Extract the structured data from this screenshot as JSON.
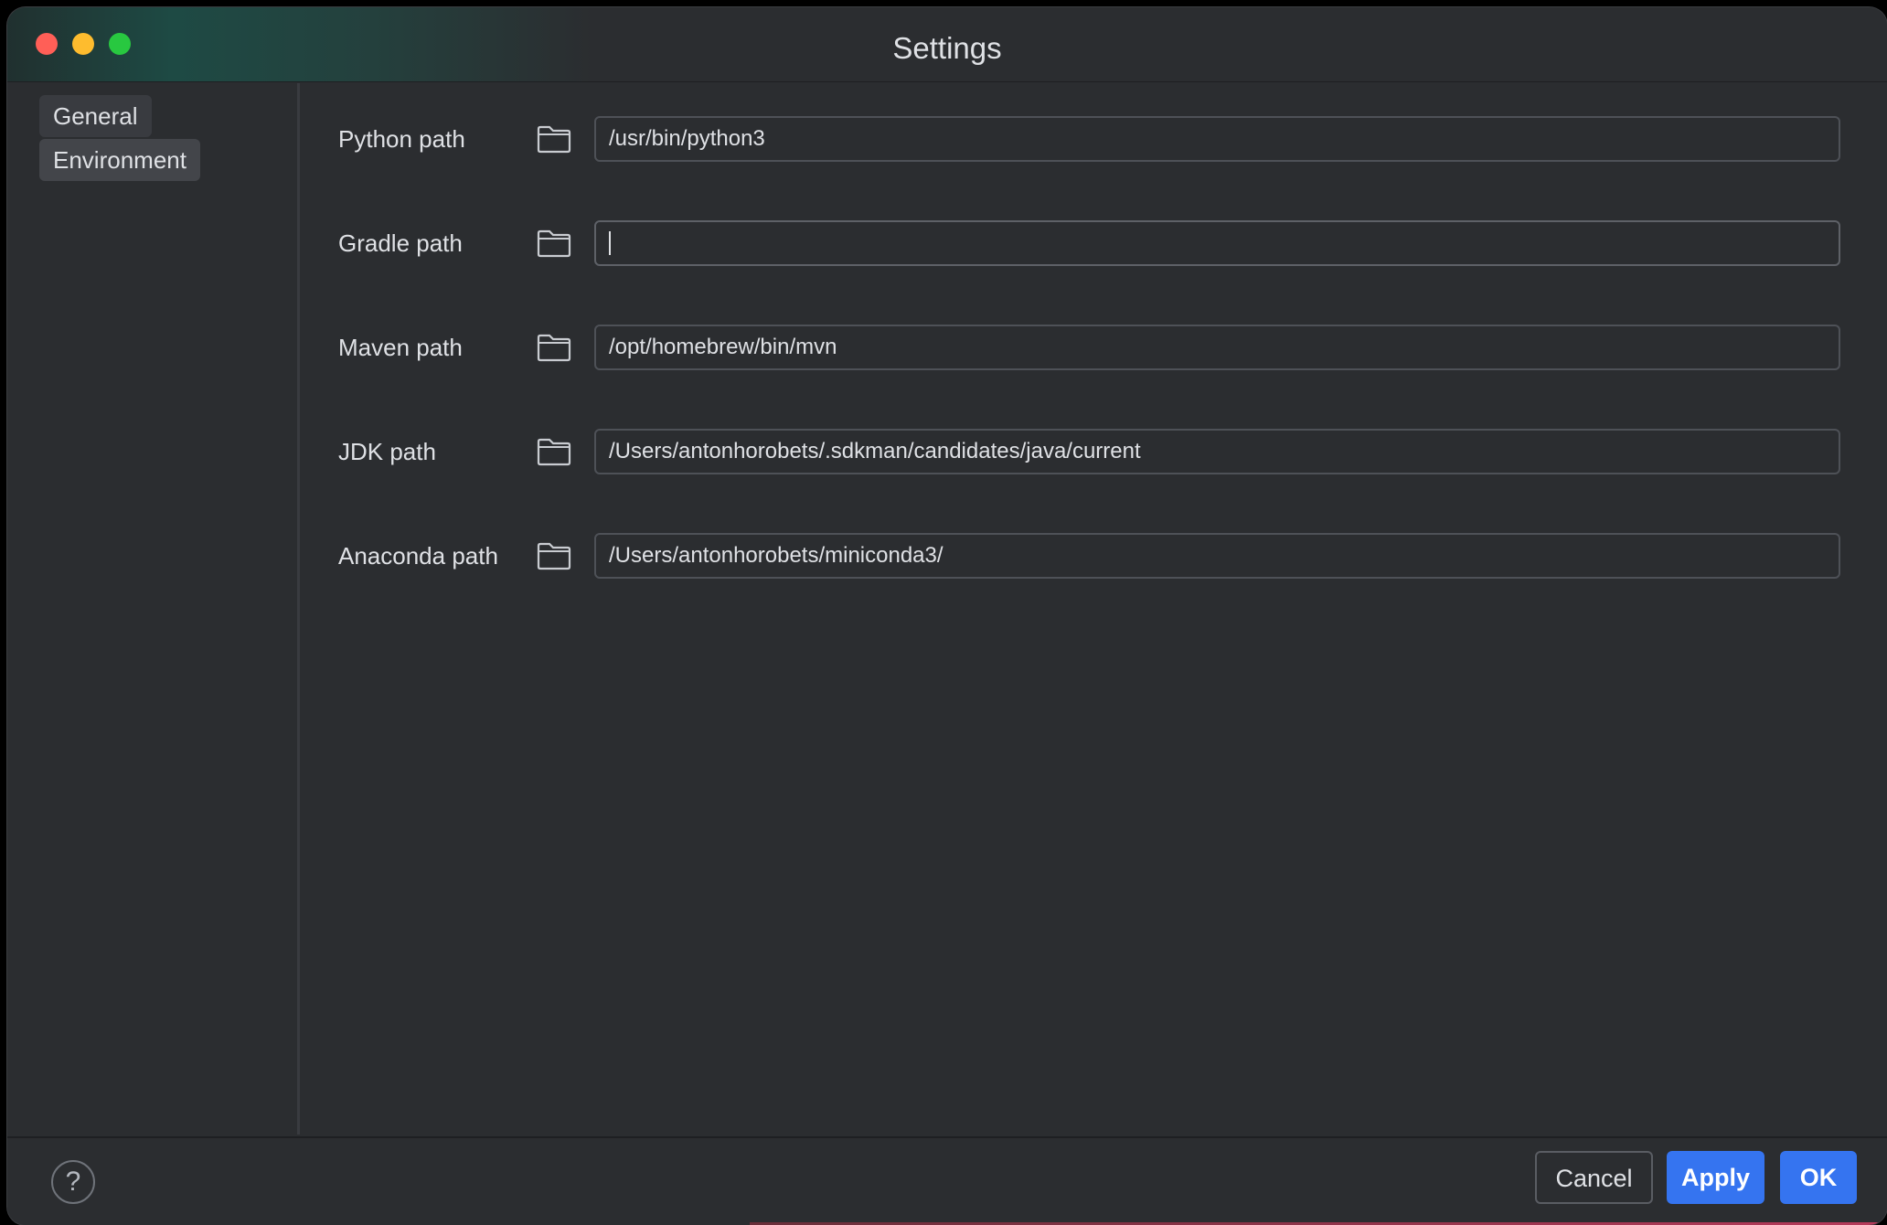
{
  "window": {
    "title": "Settings"
  },
  "sidebar": {
    "items": [
      {
        "label": "General",
        "selected": false
      },
      {
        "label": "Environment",
        "selected": true
      }
    ]
  },
  "environment": {
    "rows": [
      {
        "label": "Python path",
        "value": "/usr/bin/python3",
        "placeholder": ""
      },
      {
        "label": "Gradle path",
        "value": "",
        "placeholder": ""
      },
      {
        "label": "Maven path",
        "value": "/opt/homebrew/bin/mvn",
        "placeholder": ""
      },
      {
        "label": "JDK path",
        "value": "/Users/antonhorobets/.sdkman/candidates/java/current",
        "placeholder": ""
      },
      {
        "label": "Anaconda path",
        "value": "/Users/antonhorobets/miniconda3/",
        "placeholder": ""
      }
    ]
  },
  "footer": {
    "help_label": "?",
    "cancel_label": "Cancel",
    "apply_label": "Apply",
    "ok_label": "OK"
  },
  "colors": {
    "background": "#2b2d30",
    "accent": "#3574f0",
    "close": "#ff5f57",
    "minimize": "#febc2e",
    "maximize": "#28c840"
  },
  "icons": {
    "browse": "folder-icon",
    "help": "question-icon"
  }
}
